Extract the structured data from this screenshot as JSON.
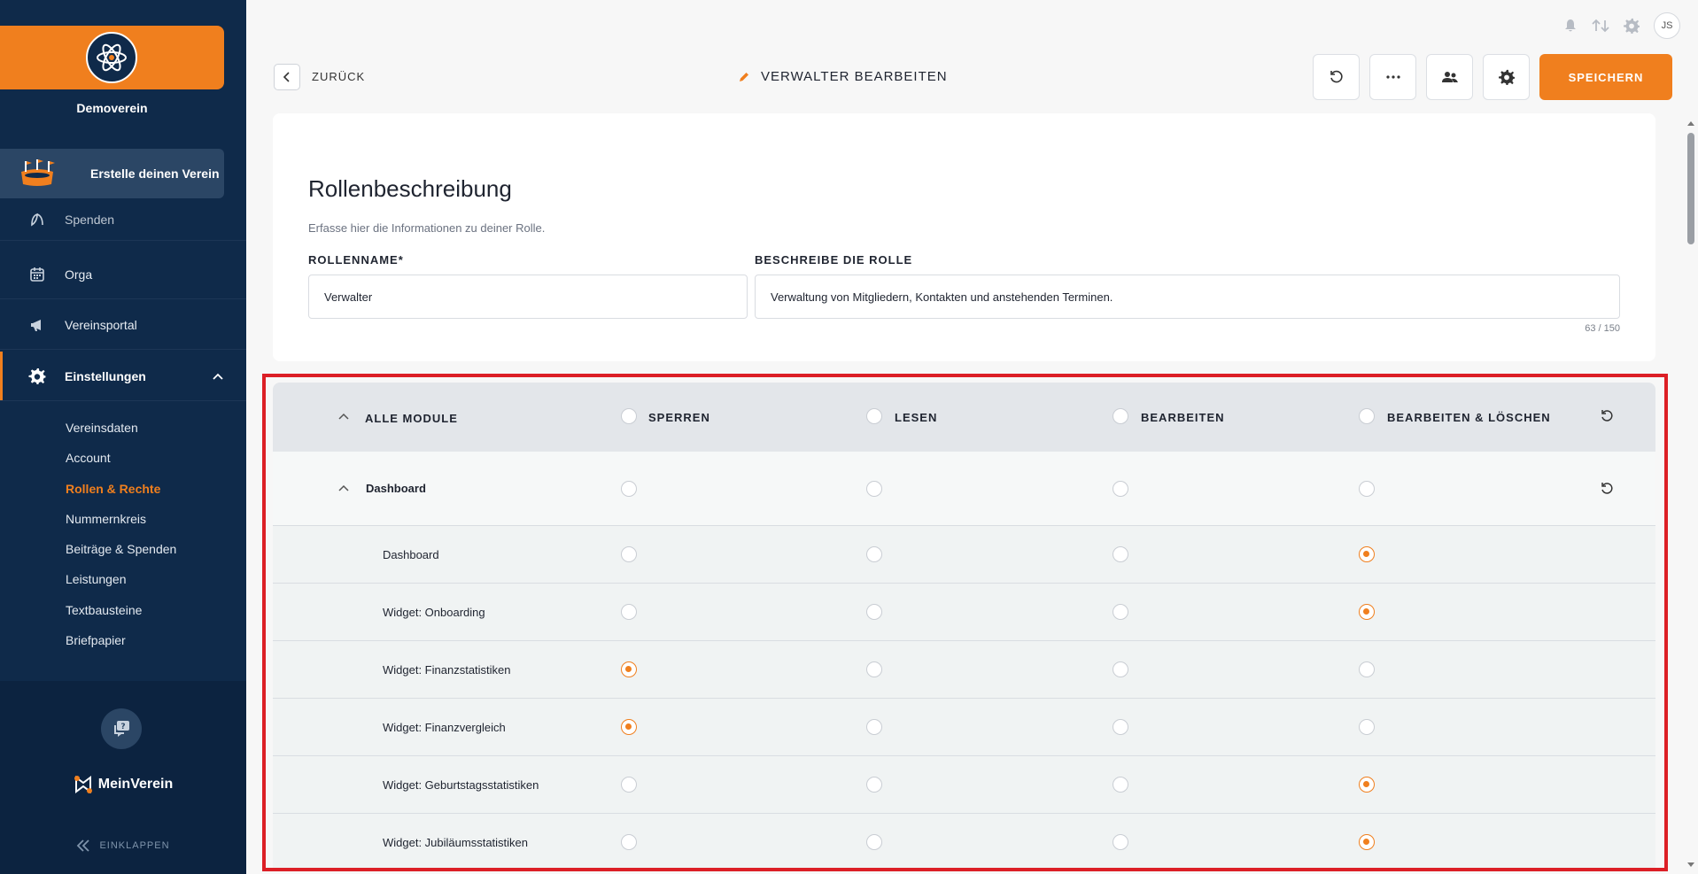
{
  "sidebar": {
    "org_name": "Demoverein",
    "create_club": "Erstelle deinen Verein",
    "items": [
      {
        "label": "Spenden",
        "icon": "leaf-icon"
      },
      {
        "label": "Orga",
        "icon": "calendar-icon"
      },
      {
        "label": "Vereinsportal",
        "icon": "megaphone-icon"
      },
      {
        "label": "Einstellungen",
        "icon": "gear-icon"
      }
    ],
    "subitems": [
      "Vereinsdaten",
      "Account",
      "Rollen & Rechte",
      "Nummernkreis",
      "Beiträge & Spenden",
      "Leistungen",
      "Textbausteine",
      "Briefpapier"
    ],
    "brand": "MeinVerein",
    "collapse": "EINKLAPPEN"
  },
  "topbar": {
    "avatar": "JS"
  },
  "header": {
    "back": "ZURÜCK",
    "title": "VERWALTER BEARBEITEN",
    "save": "SPEICHERN"
  },
  "role": {
    "title": "Rollenbeschreibung",
    "subtitle": "Erfasse hier die Informationen zu deiner Rolle.",
    "name_label": "ROLLENNAME*",
    "name_value": "Verwalter",
    "desc_label": "BESCHREIBE DIE ROLLE",
    "desc_value": "Verwaltung von Mitgliedern, Kontakten und anstehenden Terminen.",
    "counter": "63 / 150"
  },
  "permissions": {
    "all_modules": "ALLE MODULE",
    "columns": [
      "SPERREN",
      "LESEN",
      "BEARBEITEN",
      "BEARBEITEN & LÖSCHEN"
    ],
    "group": "Dashboard",
    "rows": [
      {
        "label": "Dashboard",
        "level": 3
      },
      {
        "label": "Widget: Onboarding",
        "level": 3
      },
      {
        "label": "Widget: Finanzstatistiken",
        "level": 0
      },
      {
        "label": "Widget: Finanzvergleich",
        "level": 0
      },
      {
        "label": "Widget: Geburtstagsstatistiken",
        "level": 3
      },
      {
        "label": "Widget: Jubiläumsstatistiken",
        "level": 3
      }
    ]
  },
  "colors": {
    "accent": "#f07f1e",
    "sidebar": "#0f2a4a",
    "highlight_frame": "#dc1f26"
  }
}
